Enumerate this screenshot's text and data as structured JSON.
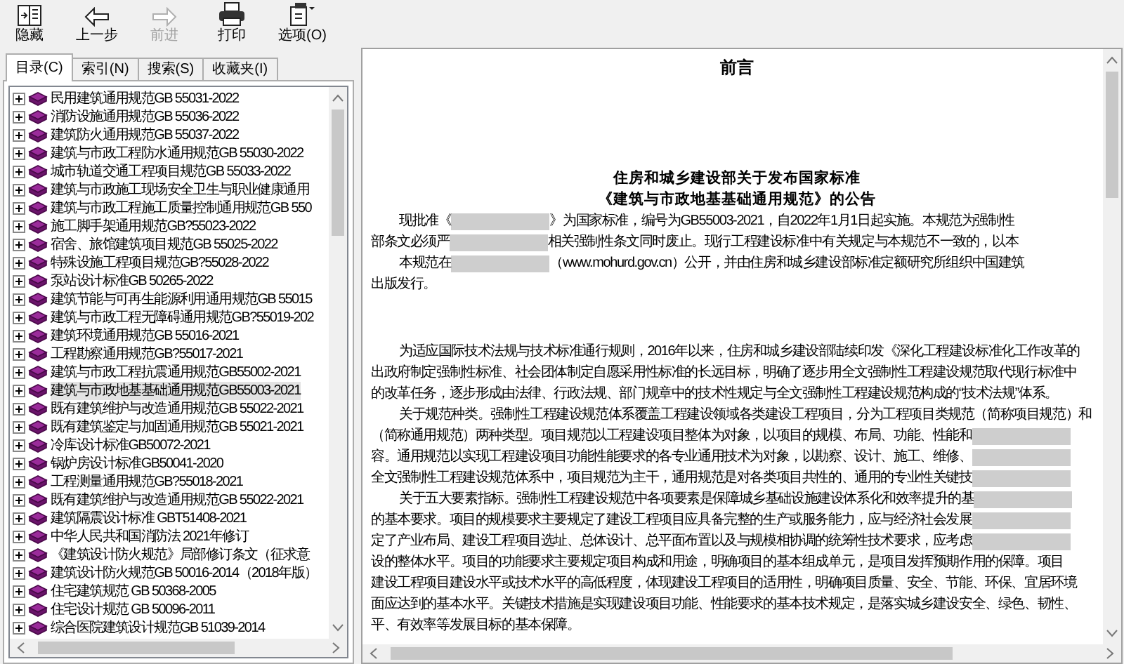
{
  "toolbar": [
    {
      "kind": "hide",
      "label": "隐藏",
      "disabled": false
    },
    {
      "kind": "back",
      "label": "上一步",
      "disabled": false
    },
    {
      "kind": "forward",
      "label": "前进",
      "disabled": true
    },
    {
      "kind": "print",
      "label": "打印",
      "disabled": false
    },
    {
      "kind": "options",
      "label": "选项(O)",
      "disabled": false
    }
  ],
  "tabs": [
    {
      "label": "目录(C)",
      "selected": true
    },
    {
      "label": "索引(N)",
      "selected": false
    },
    {
      "label": "搜索(S)",
      "selected": false
    },
    {
      "label": "收藏夹(I)",
      "selected": false
    }
  ],
  "tree": [
    {
      "label": "民用建筑通用规范GB 55031-2022",
      "selected": false
    },
    {
      "label": "消防设施通用规范GB 55036-2022",
      "selected": false
    },
    {
      "label": "建筑防火通用规范GB 55037-2022",
      "selected": false
    },
    {
      "label": "建筑与市政工程防水通用规范GB 55030-2022",
      "selected": false
    },
    {
      "label": "城市轨道交通工程项目规范GB 55033-2022",
      "selected": false
    },
    {
      "label": "建筑与市政施工现场安全卫生与职业健康通用",
      "selected": false
    },
    {
      "label": "建筑与市政工程施工质量控制通用规范GB 550",
      "selected": false
    },
    {
      "label": "施工脚手架通用规范GB?55023-2022",
      "selected": false
    },
    {
      "label": "宿舍、旅馆建筑项目规范GB 55025-2022",
      "selected": false
    },
    {
      "label": "特殊设施工程项目规范GB?55028-2022",
      "selected": false
    },
    {
      "label": "泵站设计标准GB 50265-2022",
      "selected": false
    },
    {
      "label": "建筑节能与可再生能源利用通用规范GB 55015",
      "selected": false
    },
    {
      "label": "建筑与市政工程无障碍通用规范GB?55019-202",
      "selected": false
    },
    {
      "label": "建筑环境通用规范GB 55016-2021",
      "selected": false
    },
    {
      "label": "工程勘察通用规范GB?55017-2021",
      "selected": false
    },
    {
      "label": "建筑与市政工程抗震通用规范GB55002-2021",
      "selected": false
    },
    {
      "label": "建筑与市政地基基础通用规范GB55003-2021",
      "selected": true
    },
    {
      "label": "既有建筑维护与改造通用规范GB 55022-2021",
      "selected": false
    },
    {
      "label": "既有建筑鉴定与加固通用规范GB 55021-2021",
      "selected": false
    },
    {
      "label": "冷库设计标准GB50072-2021",
      "selected": false
    },
    {
      "label": "锅炉房设计标准GB50041-2020",
      "selected": false
    },
    {
      "label": "工程测量通用规范GB?55018-2021",
      "selected": false
    },
    {
      "label": "既有建筑维护与改造通用规范GB 55022-2021",
      "selected": false
    },
    {
      "label": "建筑隔震设计标准 GBT51408-2021",
      "selected": false
    },
    {
      "label": "中华人民共和国消防法 2021年修订",
      "selected": false
    },
    {
      "label": "《建筑设计防火规范》局部修订条文（征求意",
      "selected": false
    },
    {
      "label": "建筑设计防火规范GB 50016-2014（2018年版）",
      "selected": false
    },
    {
      "label": "住宅建筑规范 GB 50368-2005",
      "selected": false
    },
    {
      "label": "住宅设计规范 GB 50096-2011",
      "selected": false
    },
    {
      "label": "综合医院建筑设计规范GB 51039-2014",
      "selected": false
    }
  ],
  "document": {
    "title": "前言",
    "heading": [
      "住房和城乡建设部关于发布国家标准",
      "《建筑与市政地基基础通用规范》的公告"
    ],
    "paragraphs": [
      {
        "lines": [
          {
            "indent": true,
            "segments": [
              {
                "kind": "text",
                "text": "现批准《"
              },
              {
                "kind": "blur"
              },
              {
                "kind": "text",
                "text": "》为国家标准，编号为GB55003-2021，自2022年1月1日起实施。本规范为强制性"
              }
            ]
          },
          {
            "indent": false,
            "segments": [
              {
                "kind": "text",
                "text": "部条文必须严"
              },
              {
                "kind": "blur"
              },
              {
                "kind": "text",
                "text": "相关强制性条文同时废止。现行工程建设标准中有关规定与本规范不一致的，以本"
              }
            ]
          },
          {
            "indent": true,
            "segments": [
              {
                "kind": "text",
                "text": "本规范在"
              },
              {
                "kind": "blur"
              },
              {
                "kind": "text",
                "text": "（www.mohurd.gov.cn）公开，并由住房和城乡建设部标准定额研究所组织中国建筑"
              }
            ]
          },
          {
            "indent": false,
            "segments": [
              {
                "kind": "text",
                "text": "出版发行。"
              }
            ]
          }
        ]
      },
      {
        "lines": [
          {
            "indent": true,
            "segments": [
              {
                "kind": "text",
                "text": "为适应国际技术法规与技术标准通行规则，2016年以来，住房和城乡建设部陆续印发《深化工程建设标准化工作改革的"
              }
            ]
          },
          {
            "indent": false,
            "segments": [
              {
                "kind": "text",
                "text": "出政府制定强制性标准、社会团体制定自愿采用性标准的长远目标，明确了逐步用全文强制性工程建设规范取代现行标准中"
              }
            ]
          },
          {
            "indent": false,
            "segments": [
              {
                "kind": "text",
                "text": "的改革任务，逐步形成由法律、行政法规、部门规章中的技术性规定与全文强制性工程建设规范构成的“技术法规”体系。"
              }
            ]
          },
          {
            "indent": true,
            "segments": [
              {
                "kind": "text",
                "text": "关于规范种类。强制性工程建设规范体系覆盖工程建设领域各类建设工程项目，分为工程项目类规范（简称项目规范）和"
              }
            ]
          },
          {
            "indent": false,
            "segments": [
              {
                "kind": "text",
                "text": "（简称通用规范）两种类型。项目规范以工程建设项目整体为对象，以项目的规模、布局、功能、性能和"
              },
              {
                "kind": "blur"
              }
            ]
          },
          {
            "indent": false,
            "segments": [
              {
                "kind": "text",
                "text": "容。通用规范以实现工程建设项目功能性能要求的各专业通用技术为对象，以勘察、设计、施工、维修、"
              },
              {
                "kind": "blur"
              }
            ]
          },
          {
            "indent": false,
            "segments": [
              {
                "kind": "text",
                "text": "全文强制性工程建设规范体系中，项目规范为主干，通用规范是对各类项目共性的、通用的专业性关键技"
              },
              {
                "kind": "blur"
              }
            ]
          },
          {
            "indent": true,
            "segments": [
              {
                "kind": "text",
                "text": "关于五大要素指标。强制性工程建设规范中各项要素是保障城乡基础设施建设体系化和效率提升的基"
              },
              {
                "kind": "blur"
              }
            ]
          },
          {
            "indent": false,
            "segments": [
              {
                "kind": "text",
                "text": "的基本要求。项目的规模要求主要规定了建设工程项目应具备完整的生产或服务能力，应与经济社会发展"
              },
              {
                "kind": "blur"
              }
            ]
          },
          {
            "indent": false,
            "segments": [
              {
                "kind": "text",
                "text": "定了产业布局、建设工程项目选址、总体设计、总平面布置以及与规模相协调的统筹性技术要求，应考虑"
              },
              {
                "kind": "blur"
              }
            ]
          },
          {
            "indent": false,
            "segments": [
              {
                "kind": "text",
                "text": "设的整体水平。项目的功能要求主要规定项目构成和用途，明确项目的基本组成单元，是项目发挥预期作用的保障。项目"
              }
            ]
          },
          {
            "indent": false,
            "segments": [
              {
                "kind": "text",
                "text": "建设工程项目建设水平或技术水平的高低程度，体现建设工程项目的适用性，明确项目质量、安全、节能、环保、宜居环境"
              }
            ]
          },
          {
            "indent": false,
            "segments": [
              {
                "kind": "text",
                "text": "面应达到的基本水平。关键技术措施是实现建设项目功能、性能要求的基本技术规定，是落实城乡建设安全、绿色、韧性、"
              }
            ]
          },
          {
            "indent": false,
            "segments": [
              {
                "kind": "text",
                "text": "平、有效率等发展目标的基本保障。"
              }
            ]
          }
        ]
      }
    ]
  }
}
